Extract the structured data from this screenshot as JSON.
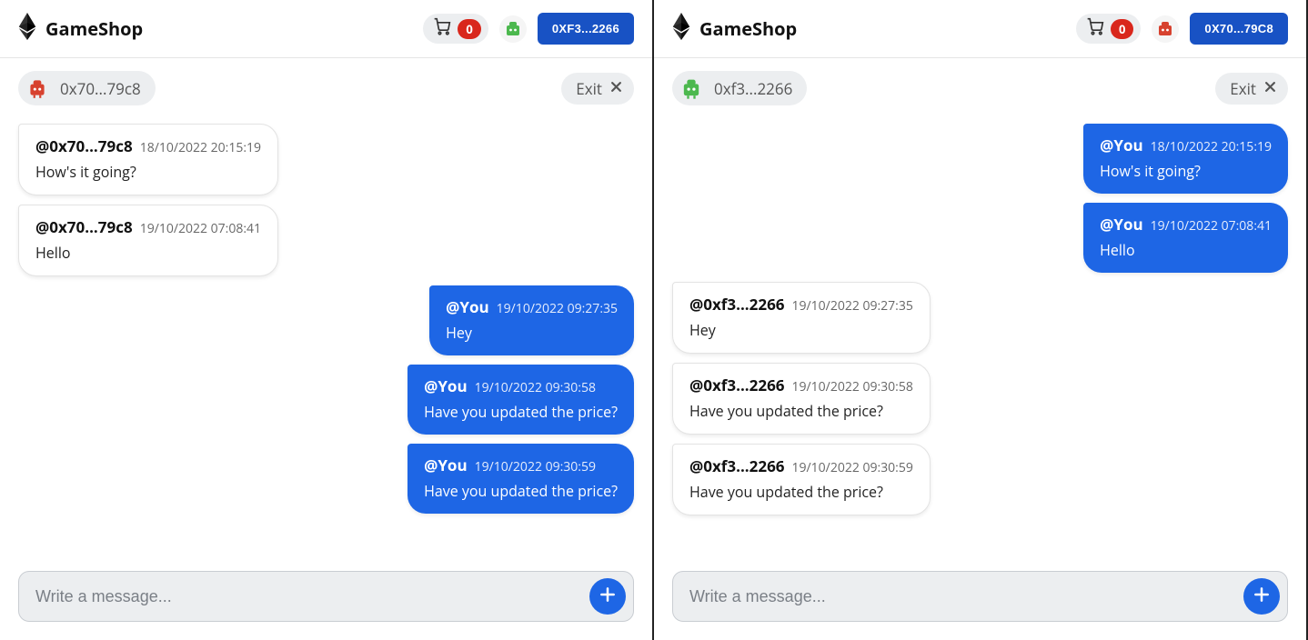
{
  "panes": [
    {
      "brand_name": "GameShop",
      "cart_count": "0",
      "wallet_label": "0XF3...2266",
      "avatar_color": "#4cb84e",
      "partner_address": "0x70...79c8",
      "partner_avatar_color": "#d7422f",
      "exit_label": "Exit",
      "compose_placeholder": "Write a message...",
      "messages": [
        {
          "side": "incoming",
          "sender": "@0x70...79c8",
          "ts": "18/10/2022 20:15:19",
          "body": "How's it going?"
        },
        {
          "side": "incoming",
          "sender": "@0x70...79c8",
          "ts": "19/10/2022 07:08:41",
          "body": "Hello"
        },
        {
          "side": "outgoing",
          "sender": "@You",
          "ts": "19/10/2022 09:27:35",
          "body": "Hey"
        },
        {
          "side": "outgoing",
          "sender": "@You",
          "ts": "19/10/2022 09:30:58",
          "body": "Have you updated the price?"
        },
        {
          "side": "outgoing",
          "sender": "@You",
          "ts": "19/10/2022 09:30:59",
          "body": "Have you updated the price?"
        }
      ]
    },
    {
      "brand_name": "GameShop",
      "cart_count": "0",
      "wallet_label": "0X70...79C8",
      "avatar_color": "#d7422f",
      "partner_address": "0xf3...2266",
      "partner_avatar_color": "#4cb84e",
      "exit_label": "Exit",
      "compose_placeholder": "Write a message...",
      "messages": [
        {
          "side": "outgoing",
          "sender": "@You",
          "ts": "18/10/2022 20:15:19",
          "body": "How's it going?"
        },
        {
          "side": "outgoing",
          "sender": "@You",
          "ts": "19/10/2022 07:08:41",
          "body": "Hello"
        },
        {
          "side": "incoming",
          "sender": "@0xf3...2266",
          "ts": "19/10/2022 09:27:35",
          "body": "Hey"
        },
        {
          "side": "incoming",
          "sender": "@0xf3...2266",
          "ts": "19/10/2022 09:30:58",
          "body": "Have you updated the price?"
        },
        {
          "side": "incoming",
          "sender": "@0xf3...2266",
          "ts": "19/10/2022 09:30:59",
          "body": "Have you updated the price?"
        }
      ]
    }
  ]
}
